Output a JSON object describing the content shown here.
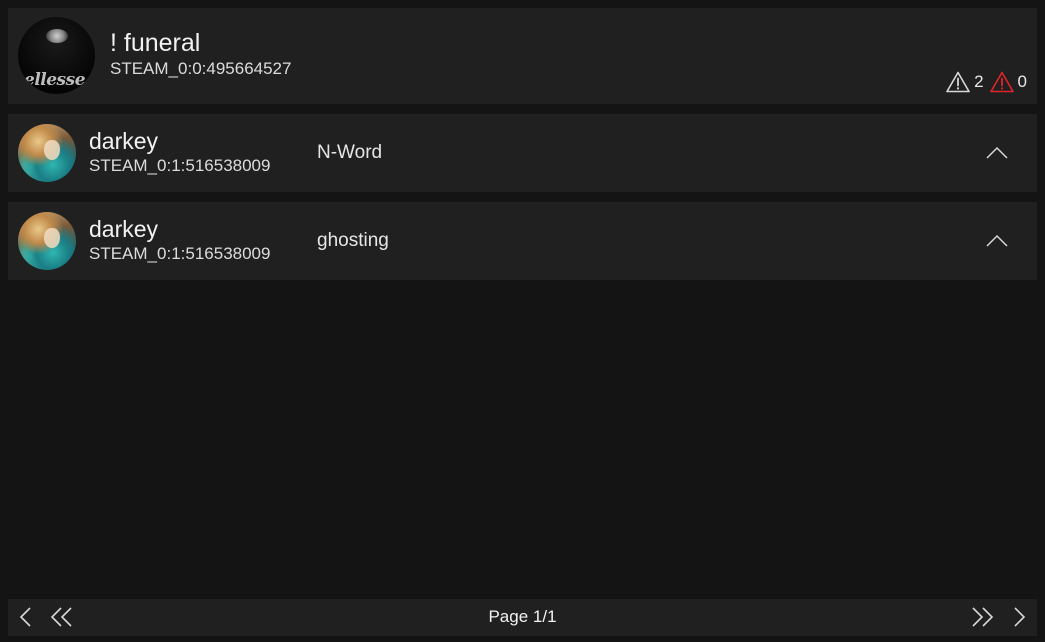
{
  "player": {
    "name": "! funeral",
    "steam_id": "STEAM_0:0:495664527",
    "avatar_icon": "player-avatar",
    "avatar_logo_text": "ellesse",
    "warnings_active": "2",
    "warnings_severe": "0",
    "warning_icon": "warning-triangle-icon",
    "warning_colors": {
      "normal": "#d8d8d8",
      "severe": "#e0252b"
    }
  },
  "warnings": [
    {
      "issuer_name": "darkey",
      "issuer_steam_id": "STEAM_0:1:516538009",
      "reason": "N-Word",
      "toggle_icon": "chevron-up-icon"
    },
    {
      "issuer_name": "darkey",
      "issuer_steam_id": "STEAM_0:1:516538009",
      "reason": "ghosting",
      "toggle_icon": "chevron-up-icon"
    }
  ],
  "pagination": {
    "label": "Page 1/1",
    "icons": [
      "chevron-left-icon",
      "double-chevron-left-icon",
      "double-chevron-right-icon",
      "chevron-right-icon"
    ]
  },
  "theme": {
    "background": "#141414",
    "card": "#202020",
    "text": "#e8e8e8"
  }
}
